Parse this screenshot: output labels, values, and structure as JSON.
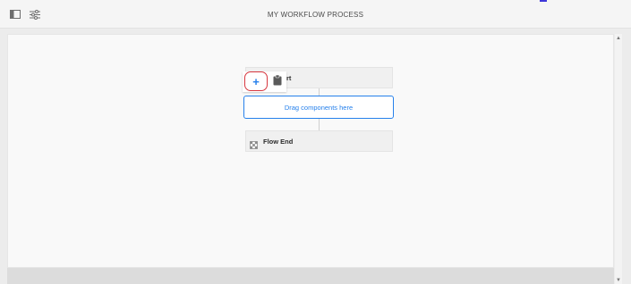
{
  "header": {
    "title": "MY WORKFLOW PROCESS",
    "icons": [
      "sidebar-toggle-icon",
      "settings-sliders-icon"
    ]
  },
  "workflow": {
    "start_label_partial": "rt",
    "dropzone_label": "Drag components here",
    "end_label": "Flow End"
  },
  "popover": {
    "add_symbol": "+",
    "icons": [
      "add-icon",
      "clipboard-paste-icon"
    ]
  },
  "colors": {
    "accent_blue": "#2680eb",
    "highlight_red": "#d7373f",
    "top_accent": "#3e37d9"
  },
  "scrollbar": {
    "up_arrow": "▲",
    "down_arrow": "▼"
  }
}
